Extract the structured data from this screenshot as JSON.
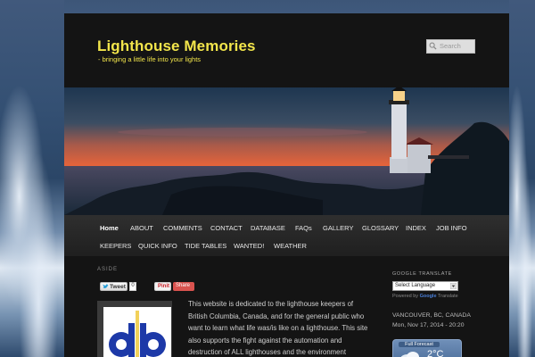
{
  "site": {
    "title": "Lighthouse Memories",
    "description": "- bringing a little life into your lights"
  },
  "search": {
    "placeholder": "Search"
  },
  "nav": {
    "items": [
      "Home",
      "ABOUT",
      "COMMENTS",
      "CONTACT",
      "DATABASE",
      "FAQs",
      "GALLERY",
      "GLOSSARY",
      "INDEX",
      "JOB INFO",
      "KEEPERS",
      "QUICK INFO",
      "TIDE TABLES",
      "WANTED!",
      "WEATHER"
    ],
    "active": "Home"
  },
  "post": {
    "format_label": "ASIDE",
    "tweet_label": "Tweet",
    "tweet_count": "0",
    "pinit_label": "Pinit",
    "share_label": "Share",
    "logo_text": "db",
    "intro": "This website is dedicated to the lighthouse keepers of British Columbia, Canada, and for the general public who want to learn what life was/is like on a lighthouse. This site also supports the fight against the automation and destruction of ALL lighthouses and the environment surrounding them."
  },
  "sidebar": {
    "translate_heading": "GOOGLE TRANSLATE",
    "language_select": "Select Language",
    "powered_by_prefix": "Powered by",
    "powered_by_brand": "Google",
    "powered_by_suffix": "Translate",
    "weather_location": "VANCOUVER, BC, CANADA",
    "weather_datetime": "Mon, Nov 17, 2014 - 20:20",
    "weather_widget_title": "Full Forecast",
    "weather_temp": "2°C"
  },
  "colors": {
    "accent_title": "#f2e54b",
    "page_bg": "#141414",
    "nav_bg": "#2a2a2a"
  }
}
